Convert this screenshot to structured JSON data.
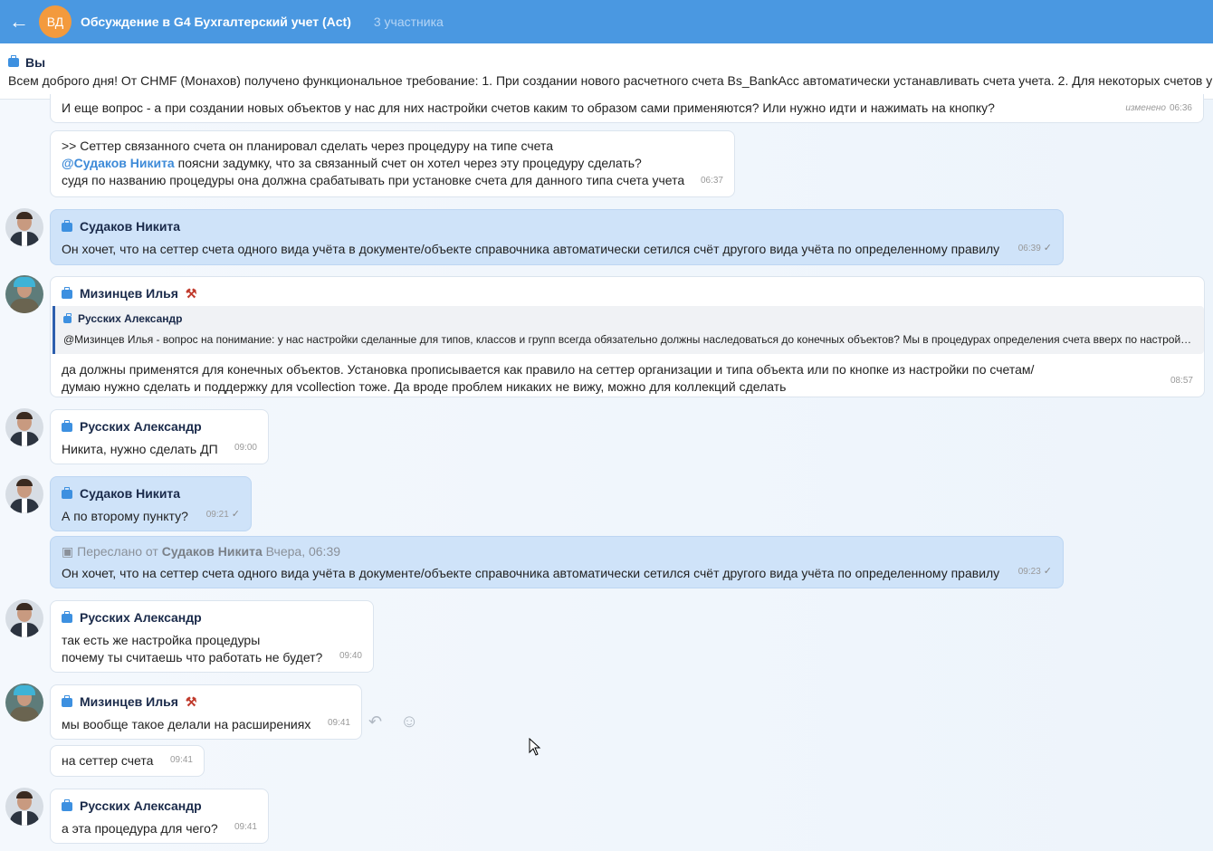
{
  "header": {
    "avatar_initials": "ВД",
    "title": "Обсуждение в G4 Бухгалтерский учет (Act)",
    "participants": "3 участника"
  },
  "pinned": {
    "author": "Вы",
    "text": "Всем доброго дня! От CHMF (Монахов) получено функциональное требование: 1. При создании нового расчетного счета Bs_BankAcc автоматически устанавливать счета учета. 2. Для некоторых счетов учета"
  },
  "messages": [
    {
      "text": "И еще вопрос - а при создании новых объектов у нас для них настройки счетов каким то образом сами применяются? Или нужно идти и нажимать на кнопку?",
      "edited": "изменено",
      "time": "06:36"
    },
    {
      "line1": ">> Сеттер связанного счета он планировал сделать через процедуру на типе счета",
      "mention": "@Судаков Никита",
      "line2": " поясни задумку, что за связанный счет он хотел через эту процедуру сделать?",
      "line3": "судя по названию процедуры она должна срабатывать при установке счета для данного типа счета учета",
      "time": "06:37"
    },
    {
      "author": "Судаков Никита",
      "text": "Он хочет, что на сеттер счета одного вида учёта в документе/объекте справочника автоматически сетился счёт другого вида учёта по определенному правилу",
      "time": "06:39"
    },
    {
      "author": "Мизинцев Илья",
      "quote_author": "Русских Александр",
      "quote_text": "@Мизинцев Илья - вопрос на понимание: у нас настройки сделанные для типов, классов и групп всегда обязательно должны наследоваться до конечных объектов? Мы в процедурах определения счета вверх по настройкам идем…",
      "line1": "да должны применятся для конечных объектов. Установка прописывается как правило на сеттер организации и типа объекта или по кнопке из настройки по счетам/",
      "line2": "думаю нужно сделать и поддержку для vcollection тоже. Да вроде проблем никаких не вижу, можно для коллекций сделать",
      "time": "08:57"
    },
    {
      "author": "Русских Александр",
      "text": "Никита, нужно сделать ДП",
      "time": "09:00"
    },
    {
      "author": "Судаков Никита",
      "text": "А по второму пункту?",
      "time": "09:21"
    },
    {
      "forward_prefix": "Переслано от",
      "forward_author": "Судаков Никита",
      "forward_date": "Вчера, 06:39",
      "text": "Он хочет, что на сеттер счета одного вида учёта в документе/объекте справочника автоматически сетился счёт другого вида учёта по определенному правилу",
      "time": "09:23"
    },
    {
      "author": "Русских Александр",
      "line1": "так есть же настройка процедуры",
      "line2": "почему ты считаешь что работать не будет?",
      "time": "09:40"
    },
    {
      "author": "Мизинцев Илья",
      "text": "мы вообще такое делали на расширениях",
      "time": "09:41"
    },
    {
      "text": "на сеттер счета",
      "time": "09:41"
    },
    {
      "author": "Русских Александр",
      "text": "а эта процедура для чего?",
      "time": "09:41"
    }
  ],
  "colors": {
    "header": "#4a98e1",
    "own_bubble": "#cfe3f9",
    "accent": "#3d8ad8"
  }
}
